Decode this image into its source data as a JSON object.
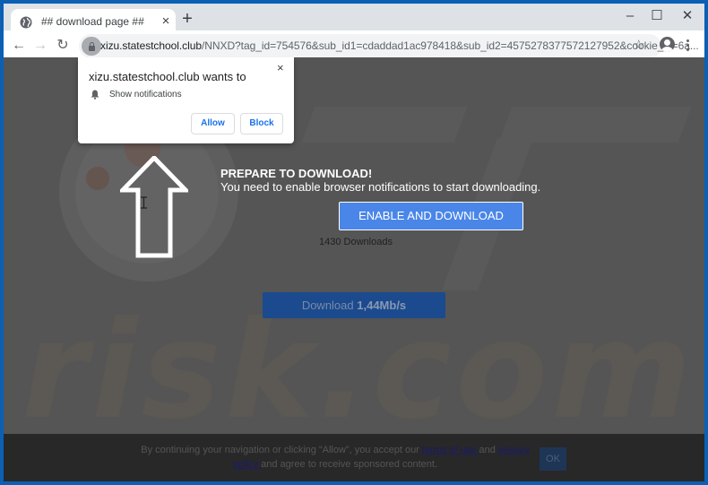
{
  "browser": {
    "tab_title": "## download page ##",
    "tab_close": "×",
    "new_tab": "+",
    "window_controls": {
      "minimize": "–",
      "maximize": "☐",
      "close": "✕"
    },
    "nav": {
      "back": "←",
      "forward": "→",
      "reload": "↻"
    },
    "url_domain": "xizu.statestchool.club",
    "url_path": "/NNXD?tag_id=754576&sub_id1=cdaddad1ac978418&sub_id2=4575278377572127952&cookie_id=6a...",
    "bookmark_icon": "☆",
    "icons": {
      "favicon": "globe-icon",
      "lock": "lock-icon",
      "profile": "account-icon",
      "menu": "kebab-menu-icon"
    }
  },
  "notification_prompt": {
    "title": "xizu.statestchool.club wants to",
    "close": "×",
    "permission": "Show notifications",
    "allow_label": "Allow",
    "block_label": "Block"
  },
  "page": {
    "headline": "PREPARE TO DOWNLOAD!",
    "subline": "You need to enable browser notifications to start downloading.",
    "cta_label": "ENABLE AND DOWNLOAD",
    "downloads_count": "1430 Downloads",
    "download_bar_prefix": "Download ",
    "download_bar_speed": "1,44Mb/s",
    "watermark": "risk.com"
  },
  "consent": {
    "text_1": "By continuing your navigation or clicking “Allow”, you accept our ",
    "terms_link": "terms of use ",
    "text_2": "and ",
    "privacy_link": "privacy policy ",
    "text_3": "and agree to receive sponsored content.",
    "ok_label": "OK"
  },
  "colors": {
    "cta_blue": "#4a86e8",
    "page_overlay": "#555555",
    "window_frame": "#0b5fb4"
  }
}
